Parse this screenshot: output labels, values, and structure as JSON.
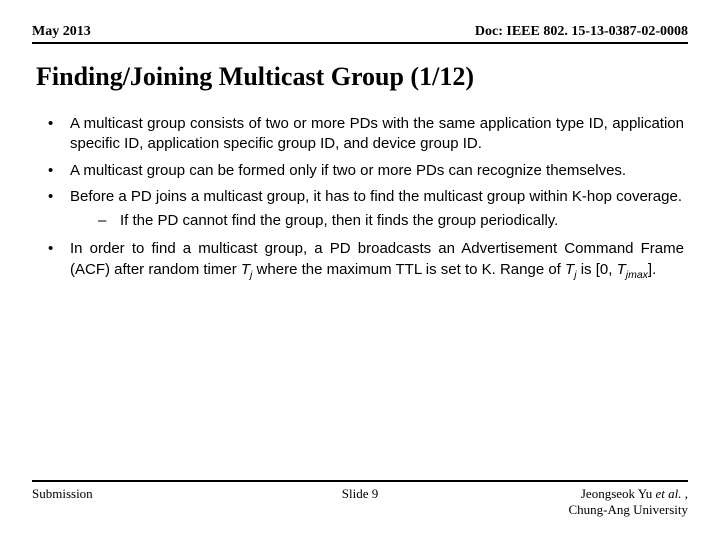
{
  "header": {
    "date": "May 2013",
    "doc": "Doc: IEEE 802. 15-13-0387-02-0008"
  },
  "title": "Finding/Joining Multicast Group (1/12)",
  "bullets": {
    "b1": "A multicast group consists of two or more PDs  with the same application type ID, application specific ID, application specific group ID, and device group ID.",
    "b2": "A multicast group can be formed only if two or more PDs can recognize themselves.",
    "b3": "Before a PD joins a multicast group, it has to find the multicast group within K-hop coverage.",
    "b3s1": "If the PD cannot find the group, then it finds the group periodically.",
    "b4a": "In order to find a multicast group, a PD broadcasts an Advertisement Command Frame (ACF) after random timer ",
    "b4b": " where the maximum TTL is set to K. Range of ",
    "b4c": " is [0, ",
    "b4d": "]."
  },
  "math": {
    "Tj": "T",
    "j": "j",
    "Tjmax": "T",
    "jmax": "jmax"
  },
  "footer": {
    "left": "Submission",
    "center": "Slide 9",
    "right1": "Jeongseok Yu ",
    "right1_ital": "et al.",
    "right1_end": " ,",
    "right2": "Chung-Ang University"
  }
}
